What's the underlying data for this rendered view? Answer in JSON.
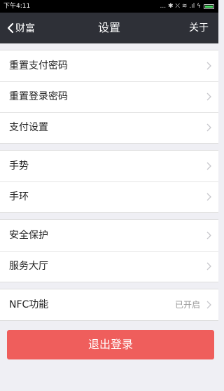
{
  "status_bar": {
    "time": "下午4:11",
    "indicators": "... ✱ ⛌ ≋ .ıl ϟ",
    "battery_icon": "battery-icon"
  },
  "nav": {
    "back_label": "财富",
    "title": "设置",
    "right_label": "关于",
    "background": "#2e3037"
  },
  "groups": [
    {
      "items": [
        {
          "label": "重置支付密码"
        },
        {
          "label": "重置登录密码"
        },
        {
          "label": "支付设置"
        }
      ]
    },
    {
      "items": [
        {
          "label": "手势"
        },
        {
          "label": "手环"
        }
      ]
    },
    {
      "items": [
        {
          "label": "安全保护"
        },
        {
          "label": "服务大厅"
        }
      ]
    },
    {
      "items": [
        {
          "label": "NFC功能",
          "value": "已开启"
        }
      ]
    }
  ],
  "logout": {
    "label": "退出登录",
    "color": "#ef5e5c"
  },
  "colors": {
    "background": "#efeff4",
    "chevron": "#c7c7cc"
  }
}
